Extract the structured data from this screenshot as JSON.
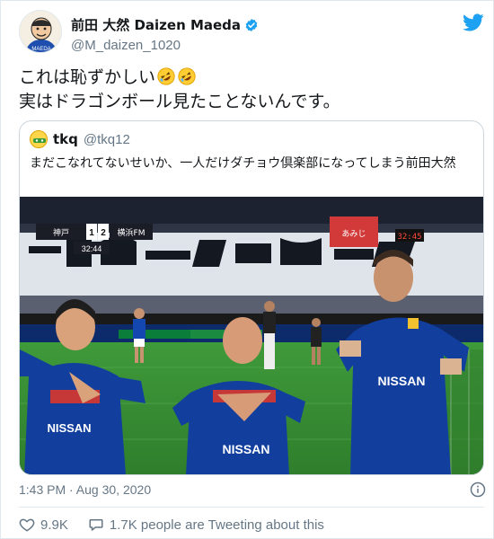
{
  "author": {
    "display_name": "前田 大然 Daizen Maeda",
    "handle": "@M_daizen_1020",
    "verified": true
  },
  "tweet": {
    "line1": "これは恥ずかしい",
    "line1_emojis": [
      "rolling-on-floor-laughing-emoji",
      "rolling-on-floor-laughing-emoji"
    ],
    "line2": "実はドラゴンボール見たことないんです。"
  },
  "quoted_tweet": {
    "name": "tkq",
    "handle": "@tkq12",
    "text": "まだこなれてないせいか、一人だけダチョウ倶楽部になってしまう前田大然"
  },
  "scoreboard": {
    "team1": "神戸",
    "score1": "1",
    "score2": "2",
    "team2": "横浜FM",
    "clock": "32:44",
    "clock_right": "32:45"
  },
  "meta": {
    "timestamp": "1:43 PM · Aug 30, 2020"
  },
  "actions": {
    "likes": "9.9K",
    "retweets_text": "1.7K people are Tweeting about this"
  },
  "colors": {
    "twitter_blue": "#1da1f2",
    "text_gray": "#657786",
    "kit_blue": "#123f9e"
  }
}
